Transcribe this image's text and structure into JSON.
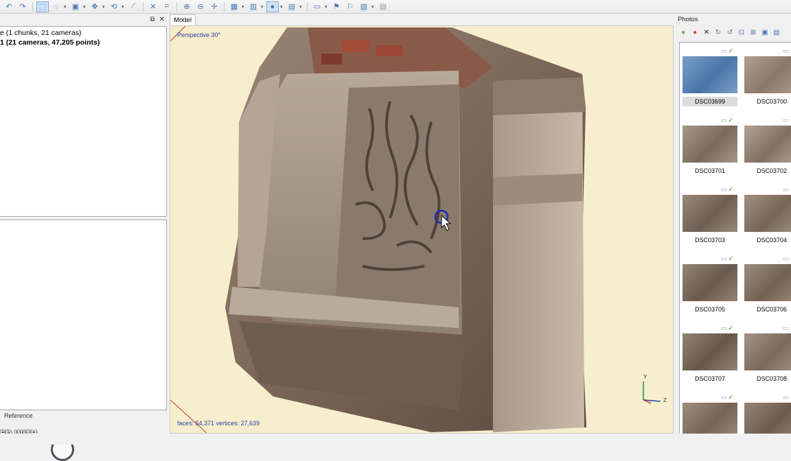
{
  "toolbar": {
    "icons": [
      "undo-icon",
      "redo-icon",
      "select-icon",
      "lasso-icon",
      "box-icon",
      "move-icon",
      "rotate-icon",
      "ruler-icon",
      "delete-icon",
      "crop-icon",
      "zoom-in-icon",
      "zoom-out-icon",
      "pan-icon",
      "grid-icon",
      "columns-icon",
      "shading-icon",
      "texture-icon",
      "camera-icon",
      "flag-icon",
      "marker-icon",
      "image-icon",
      "print-icon"
    ]
  },
  "workspace": {
    "lines": [
      {
        "text": "e (1 chunks, 21 cameras)",
        "bold": false
      },
      {
        "text": "1 (21 cameras, 47,205 points)",
        "bold": true
      }
    ],
    "reference_tab": "Reference",
    "watermark": "ED WITH"
  },
  "model": {
    "tab_label": "Model",
    "perspective": "Perspective 30°",
    "stats": "faces: 54,371 vertices: 27,639",
    "axis_y": "Y",
    "axis_z": "Z"
  },
  "photos": {
    "title": "Photos",
    "items": [
      {
        "name": "DSC03699",
        "selected": true,
        "enabled": true
      },
      {
        "name": "DSC03700",
        "selected": false,
        "enabled": true
      },
      {
        "name": "DSC03701",
        "selected": false,
        "enabled": true
      },
      {
        "name": "DSC03702",
        "selected": false,
        "enabled": true
      },
      {
        "name": "DSC03703",
        "selected": false,
        "enabled": true
      },
      {
        "name": "DSC03704",
        "selected": false,
        "enabled": true
      },
      {
        "name": "DSC03705",
        "selected": false,
        "enabled": true
      },
      {
        "name": "DSC03706",
        "selected": false,
        "enabled": true
      },
      {
        "name": "DSC03707",
        "selected": false,
        "enabled": true
      },
      {
        "name": "DSC03708",
        "selected": false,
        "enabled": true
      },
      {
        "name": "",
        "selected": false,
        "enabled": true
      },
      {
        "name": "",
        "selected": false,
        "enabled": true
      }
    ]
  },
  "colors": {
    "viewport_bg": "#f6eecc",
    "accent": "#2a3fa8",
    "check_green": "#5fb33a"
  }
}
